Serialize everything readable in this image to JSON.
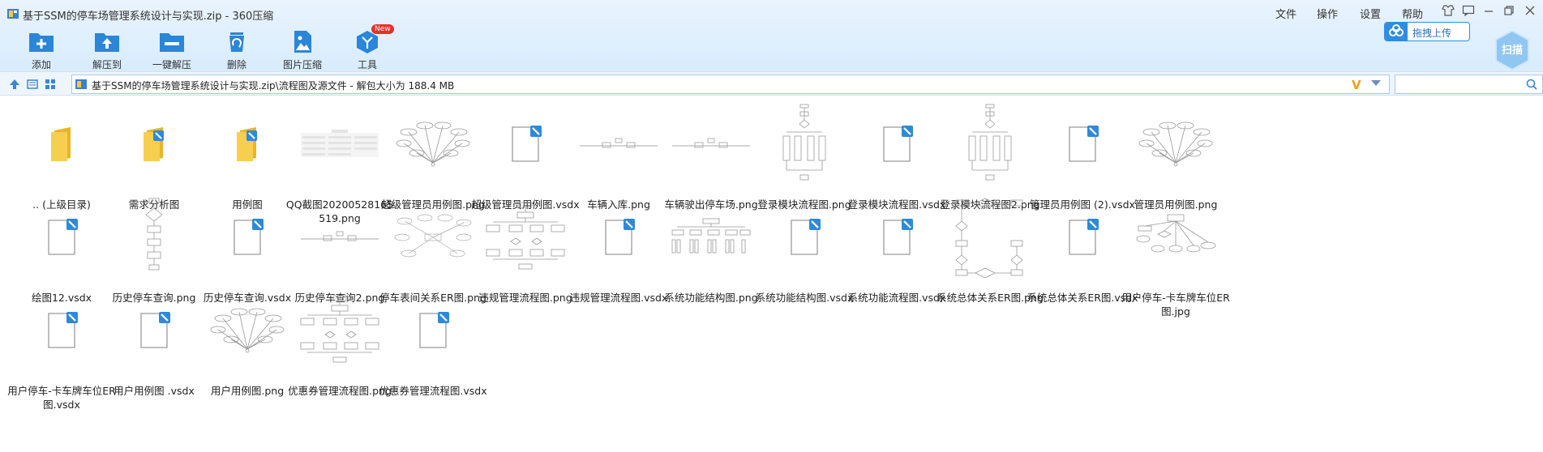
{
  "titlebar": {
    "title": "基于SSM的停车场管理系统设计与实现.zip - 360压缩",
    "menus": [
      "文件",
      "操作",
      "设置",
      "帮助"
    ]
  },
  "toolbar": {
    "add": "添加",
    "extract_to": "解压到",
    "one_click_extract": "一键解压",
    "delete": "删除",
    "image_compress": "图片压缩",
    "tools": "工具",
    "new_badge": "New"
  },
  "upload": {
    "label": "拖拽上传"
  },
  "scan": {
    "label": "扫描"
  },
  "address": {
    "path": "基于SSM的停车场管理系统设计与实现.zip\\流程图及源文件 - 解包大小为 188.4 MB",
    "search_placeholder": ""
  },
  "colors": {
    "accent": "#2f8ee0",
    "folder": "#f5c842",
    "badge": "#e8302a"
  },
  "files": [
    {
      "name": ".. (上级目录)",
      "kind": "folder-up"
    },
    {
      "name": "需求分析图",
      "kind": "folder"
    },
    {
      "name": "用例图",
      "kind": "folder"
    },
    {
      "name": "QQ截图20200528165519.png",
      "kind": "img-table"
    },
    {
      "name": "超级管理员用例图.png",
      "kind": "img-usecase"
    },
    {
      "name": "超级管理员用例图.vsdx",
      "kind": "vsdx"
    },
    {
      "name": "车辆入库.png",
      "kind": "img-line"
    },
    {
      "name": "车辆驶出停车场.png",
      "kind": "img-line"
    },
    {
      "name": "登录模块流程图.png",
      "kind": "img-flow-tall"
    },
    {
      "name": "登录模块流程图.vsdx",
      "kind": "vsdx"
    },
    {
      "name": "登录模块流程图2.png",
      "kind": "img-flow-tall"
    },
    {
      "name": "管理员用例图 (2).vsdx",
      "kind": "vsdx"
    },
    {
      "name": "管理员用例图.png",
      "kind": "img-usecase"
    },
    {
      "name": "绘图12.vsdx",
      "kind": "vsdx"
    },
    {
      "name": "历史停车查询.png",
      "kind": "img-flow-narrow"
    },
    {
      "name": "历史停车查询.vsdx",
      "kind": "vsdx"
    },
    {
      "name": "历史停车查询2.png",
      "kind": "img-line"
    },
    {
      "name": "停车表间关系ER图.png",
      "kind": "img-er"
    },
    {
      "name": "违规管理流程图.png",
      "kind": "img-flow-wide"
    },
    {
      "name": "违规管理流程图.vsdx",
      "kind": "vsdx"
    },
    {
      "name": "系统功能结构图.png",
      "kind": "img-tree"
    },
    {
      "name": "系统功能结构图.vsdx",
      "kind": "vsdx"
    },
    {
      "name": "系统功能流程图.vsdx",
      "kind": "vsdx"
    },
    {
      "name": "系统总体关系ER图.png",
      "kind": "img-er-box"
    },
    {
      "name": "系统总体关系ER图.vsdx",
      "kind": "vsdx"
    },
    {
      "name": "用户停车-卡车牌车位ER图.jpg",
      "kind": "img-er-small"
    },
    {
      "name": "用户停车-卡车牌车位ER图.vsdx",
      "kind": "vsdx"
    },
    {
      "name": "用户用例图 .vsdx",
      "kind": "vsdx"
    },
    {
      "name": "用户用例图.png",
      "kind": "img-usecase"
    },
    {
      "name": "优惠券管理流程图.png",
      "kind": "img-flow-wide"
    },
    {
      "name": "优惠券管理流程图.vsdx",
      "kind": "vsdx"
    }
  ]
}
